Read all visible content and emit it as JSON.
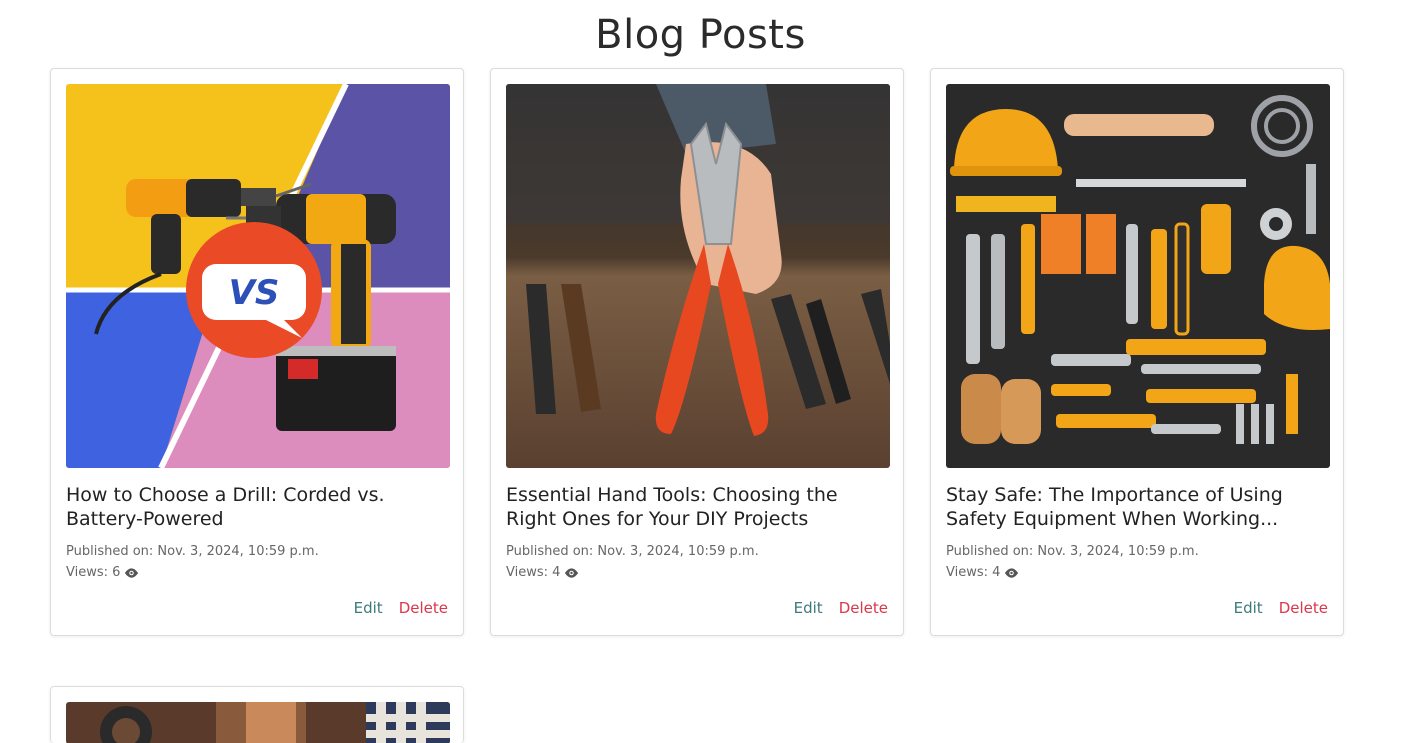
{
  "page": {
    "title": "Blog Posts"
  },
  "posts": [
    {
      "title_line1": "How to Choose a Drill: Corded vs.",
      "title_line2": "Battery-Powered",
      "published": "Published on: Nov. 3, 2024, 10:59 p.m.",
      "views": "Views: 6",
      "edit_label": "Edit",
      "delete_label": "Delete",
      "badge_text": "VS"
    },
    {
      "title_line1": "Essential Hand Tools: Choosing the",
      "title_line2": "Right Ones for Your DIY Projects",
      "published": "Published on: Nov. 3, 2024, 10:59 p.m.",
      "views": "Views: 4",
      "edit_label": "Edit",
      "delete_label": "Delete"
    },
    {
      "title_line1": "Stay Safe: The Importance of Using",
      "title_line2": "Safety Equipment When Working...",
      "published": "Published on: Nov. 3, 2024, 10:59 p.m.",
      "views": "Views: 4",
      "edit_label": "Edit",
      "delete_label": "Delete"
    }
  ],
  "icons": {
    "views": "eye-icon"
  },
  "colors": {
    "edit": "#3d7a7a",
    "delete": "#d9374a",
    "meta": "#666666"
  }
}
